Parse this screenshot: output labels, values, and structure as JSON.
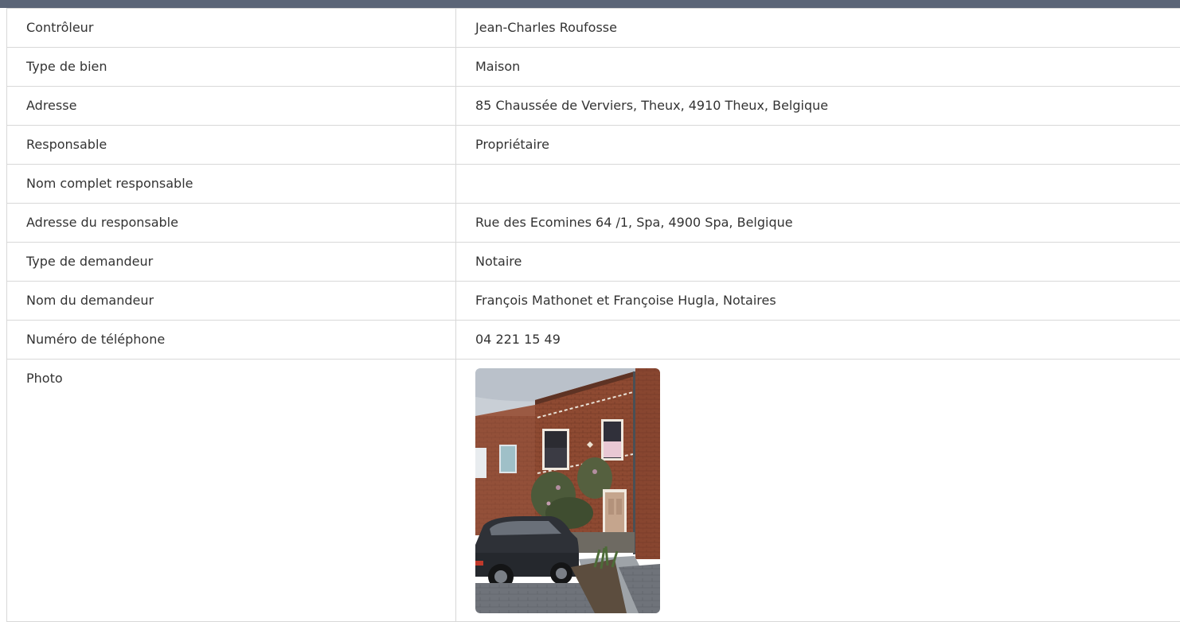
{
  "rows": [
    {
      "label": "Contrôleur",
      "value": "Jean-Charles Roufosse"
    },
    {
      "label": "Type de bien",
      "value": "Maison"
    },
    {
      "label": "Adresse",
      "value": "85 Chaussée de Verviers, Theux, 4910 Theux, Belgique"
    },
    {
      "label": "Responsable",
      "value": "Propriétaire"
    },
    {
      "label": "Nom complet responsable",
      "value": ""
    },
    {
      "label": "Adresse du responsable",
      "value": "Rue des Ecomines 64 /1, Spa, 4900 Spa, Belgique"
    },
    {
      "label": "Type de demandeur",
      "value": "Notaire"
    },
    {
      "label": "Nom du demandeur",
      "value": "François Mathonet et Françoise Hugla, Notaires"
    },
    {
      "label": "Numéro de téléphone",
      "value": "04 221 15 49"
    }
  ],
  "photo": {
    "label": "Photo"
  },
  "colors": {
    "header_bar": "#5b6577",
    "border": "#d8d8d8",
    "text": "#333333"
  }
}
